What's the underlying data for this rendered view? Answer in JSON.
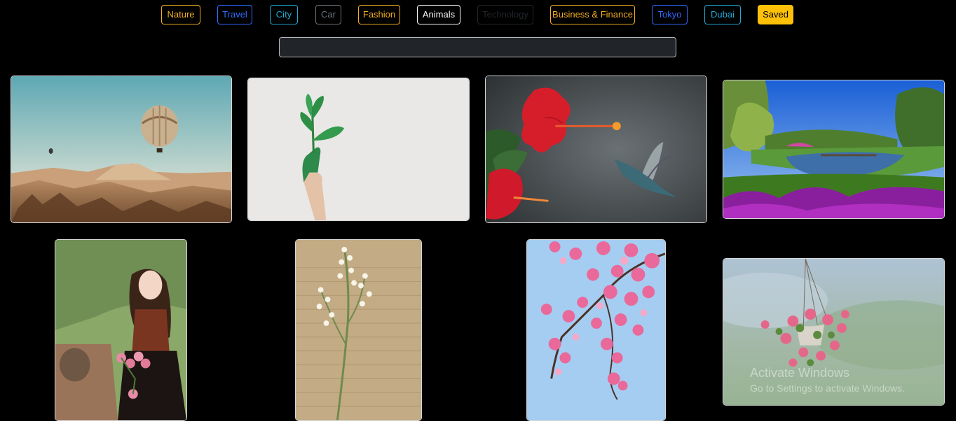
{
  "tabs": [
    {
      "label": "Nature",
      "color": "#f0ad1f"
    },
    {
      "label": "Travel",
      "color": "#2f6bff"
    },
    {
      "label": "City",
      "color": "#1fa9d4"
    },
    {
      "label": "Car",
      "color": "#6c757d"
    },
    {
      "label": "Fashion",
      "color": "#f0ad1f"
    },
    {
      "label": "Animals",
      "color": "#f8f9fa"
    },
    {
      "label": "Technology",
      "color": "#212529"
    },
    {
      "label": "Business & Finance",
      "color": "#f0ad1f"
    },
    {
      "label": "Tokyo",
      "color": "#2f6bff"
    },
    {
      "label": "Dubai",
      "color": "#1fa9d4"
    },
    {
      "label": "Saved",
      "color": "#ffc107"
    }
  ],
  "search": {
    "value": "",
    "placeholder": ""
  },
  "images": [
    {
      "icon": "hot-air-balloon-image"
    },
    {
      "icon": "green-hand-plant-image"
    },
    {
      "icon": "hibiscus-hummingbird-image"
    },
    {
      "icon": "park-lake-flowers-image"
    },
    {
      "icon": "woman-with-tulips-image"
    },
    {
      "icon": "lily-of-the-valley-image"
    },
    {
      "icon": "cherry-blossom-branch-image"
    },
    {
      "icon": "hanging-flower-basket-image"
    }
  ],
  "watermark": {
    "line1": "Activate Windows",
    "line2": "Go to Settings to activate Windows."
  }
}
